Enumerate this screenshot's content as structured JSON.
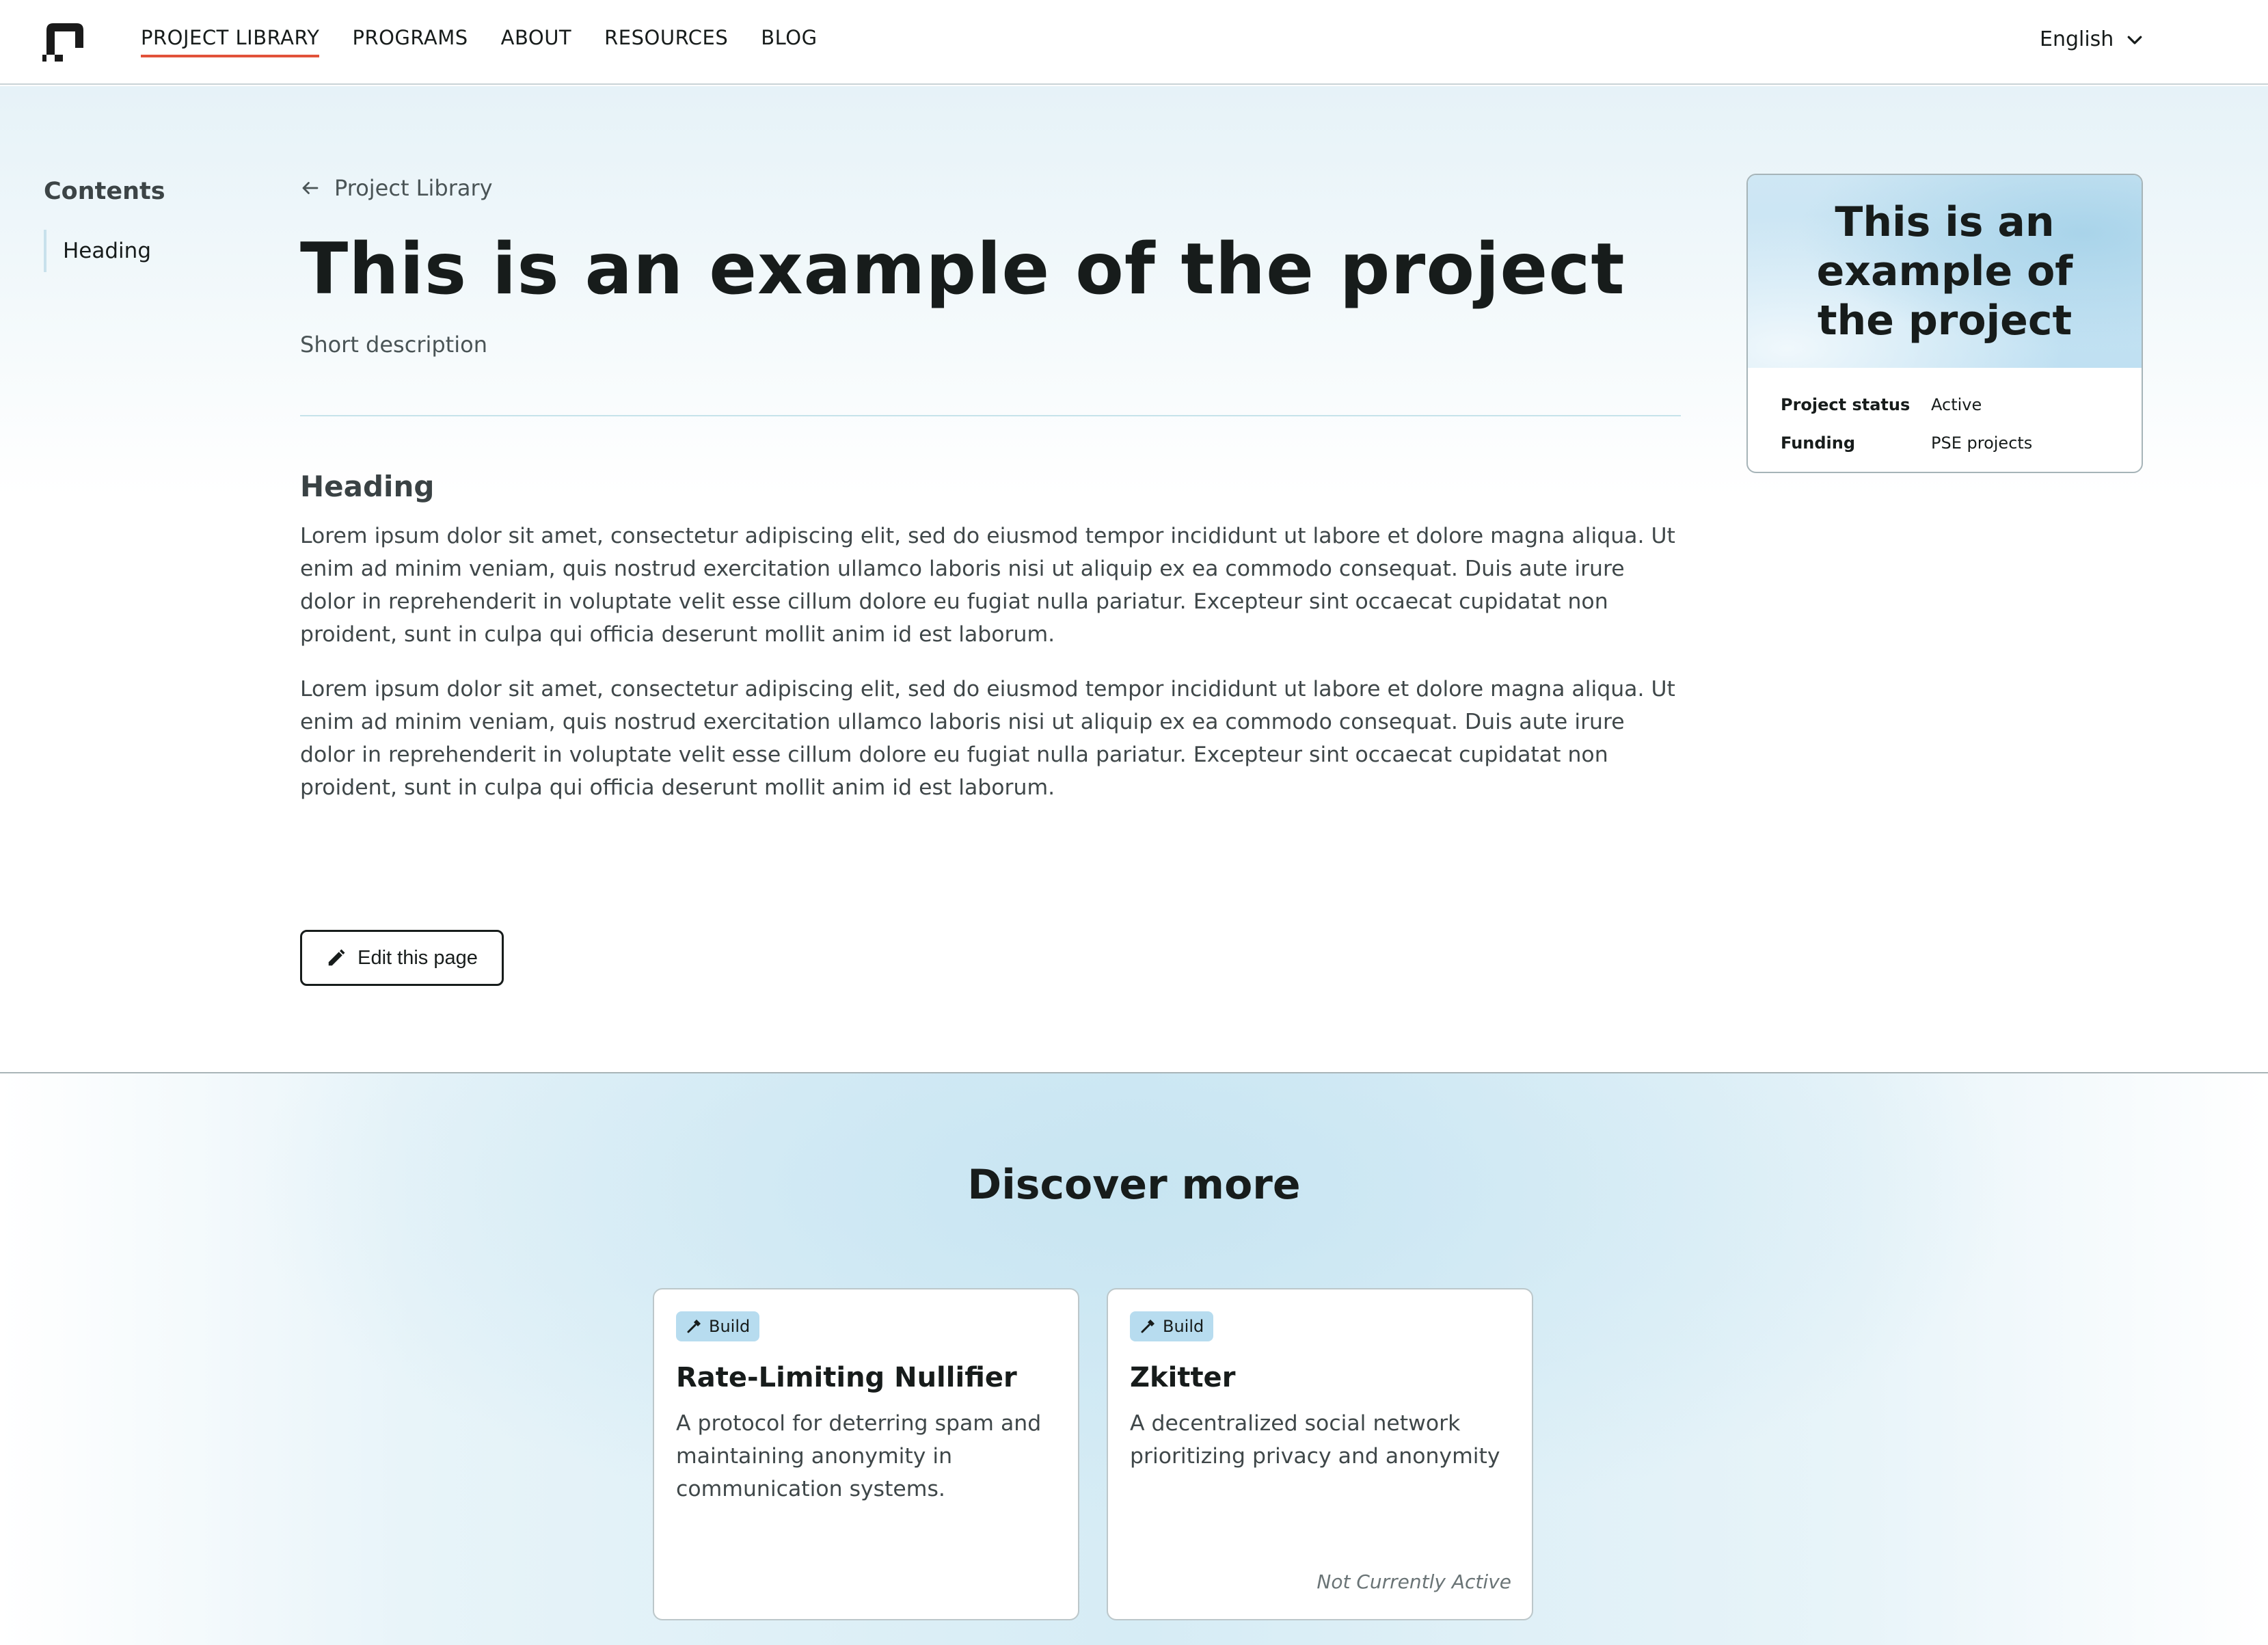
{
  "header": {
    "logo_icon": "brand-logo-icon",
    "nav": [
      {
        "label": "PROJECT LIBRARY",
        "active": true
      },
      {
        "label": "PROGRAMS",
        "active": false
      },
      {
        "label": "ABOUT",
        "active": false
      },
      {
        "label": "RESOURCES",
        "active": false
      },
      {
        "label": "BLOG",
        "active": false
      }
    ],
    "language": "English",
    "language_icon": "chevron-down-icon"
  },
  "toc": {
    "title": "Contents",
    "items": [
      "Heading"
    ]
  },
  "project": {
    "back_label": "Project Library",
    "back_icon": "arrow-left-icon",
    "title": "This is an example of the project",
    "short_description": "Short description",
    "section_heading": "Heading",
    "paragraphs": [
      "Lorem ipsum dolor sit amet, consectetur adipiscing elit, sed do eiusmod tempor incididunt ut labore et dolore magna aliqua. Ut enim ad minim veniam, quis nostrud exercitation ullamco laboris nisi ut aliquip ex ea commodo consequat. Duis aute irure dolor in reprehenderit in voluptate velit esse cillum dolore eu fugiat nulla pariatur. Excepteur sint occaecat cupidatat non proident, sunt in culpa qui officia deserunt mollit anim id est laborum.",
      "Lorem ipsum dolor sit amet, consectetur adipiscing elit, sed do eiusmod tempor incididunt ut labore et dolore magna aliqua. Ut enim ad minim veniam, quis nostrud exercitation ullamco laboris nisi ut aliquip ex ea commodo consequat. Duis aute irure dolor in reprehenderit in voluptate velit esse cillum dolore eu fugiat nulla pariatur. Excepteur sint occaecat cupidatat non proident, sunt in culpa qui officia deserunt mollit anim id est laborum."
    ],
    "edit_label": "Edit this page",
    "edit_icon": "pencil-icon"
  },
  "side_card": {
    "title": "This is an example of the project",
    "meta": [
      {
        "label": "Project status",
        "value": "Active"
      },
      {
        "label": "Funding",
        "value": "PSE projects"
      }
    ]
  },
  "discover": {
    "title": "Discover more",
    "cards": [
      {
        "badge": "Build",
        "badge_icon": "hammer-icon",
        "title": "Rate-Limiting Nullifier",
        "description": "A protocol for deterring spam and maintaining anonymity in communication systems.",
        "status": ""
      },
      {
        "badge": "Build",
        "badge_icon": "hammer-icon",
        "title": "Zkitter",
        "description": "A decentralized social network prioritizing privacy and anonymity",
        "status": "Not Currently Active"
      }
    ]
  },
  "colors": {
    "accent_underline": "#e1523a",
    "badge_bg": "#b7dcef",
    "text_dark": "#171c1b"
  }
}
